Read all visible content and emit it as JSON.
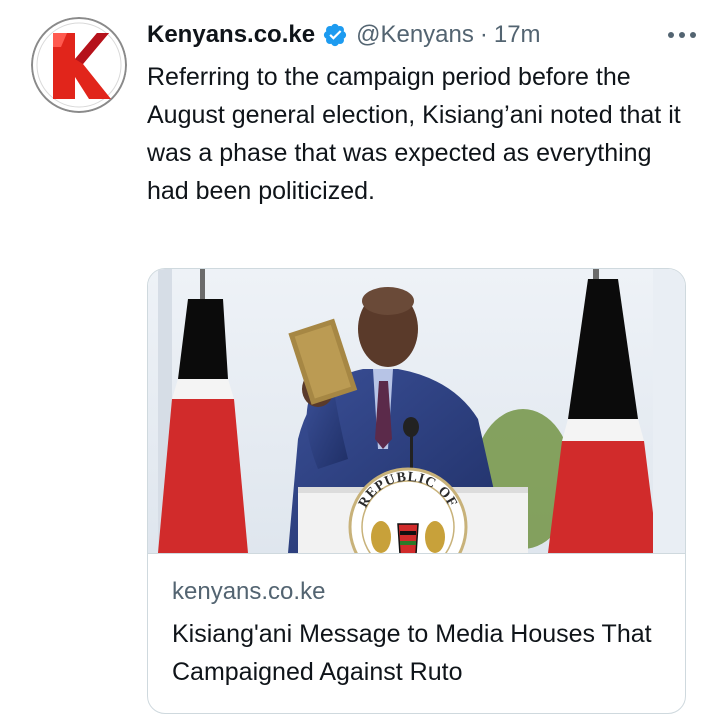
{
  "tweet": {
    "display_name": "Kenyans.co.ke",
    "handle": "@Kenyans",
    "separator": "·",
    "time": "17m",
    "text": "Referring to the campaign period before the August general election, Kisiang’ani noted that it was a phase that was expected as everything had been politicized.",
    "avatar_icon": "kenyans-logo-icon",
    "verified_icon": "verified-badge-icon",
    "more_icon": "more-options-icon"
  },
  "card": {
    "domain": "kenyans.co.ke",
    "title": "Kisiang'ani Message to Media Houses That Campaigned Against Ruto",
    "podium_text": "REPUBLIC OF"
  },
  "colors": {
    "text": "#0f1419",
    "secondary": "#536471",
    "verified": "#1d9bf0",
    "brand_red": "#e1251b",
    "border": "#cfd9de"
  }
}
